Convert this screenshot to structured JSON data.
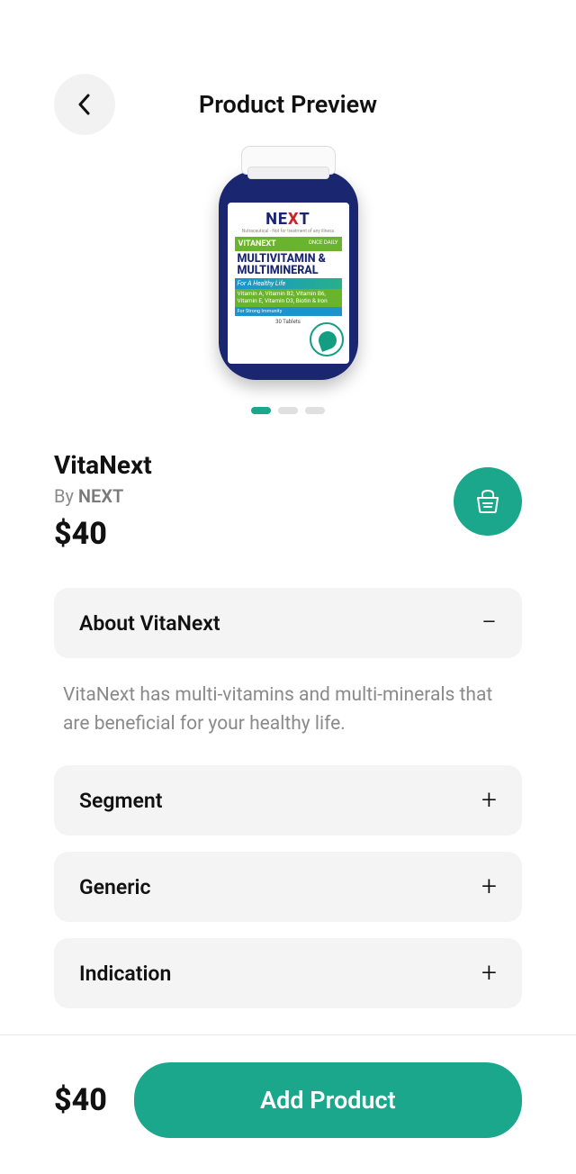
{
  "header": {
    "title": "Product Preview"
  },
  "product": {
    "name": "VitaNext",
    "by_prefix": "By ",
    "brand": "NEXT",
    "price": "$40",
    "bottle_label": {
      "brand_left": "NE",
      "brand_x": "X",
      "brand_right": "T",
      "sub": "Nutraceutical - Not for treatment of any illness",
      "vitanext": "VITANEXT",
      "oncedaily": "ONCE DAILY",
      "multivit": "MULTIVITAMIN & MULTIMINERAL",
      "healthy": "For A Healthy Life",
      "vitamins": "Vitamin A, Vitamin B2, Vitamin B6, Vitamin E, Vitamin D3, Biotin & Iron",
      "immunity": "For Strong Immunity",
      "tablets": "30 Tablets"
    }
  },
  "pagination": {
    "count": 3,
    "active": 0
  },
  "accordion": [
    {
      "title": "About VitaNext",
      "expanded": true,
      "content": "VitaNext has multi-vitamins and multi-minerals that are beneficial for your healthy life."
    },
    {
      "title": "Segment",
      "expanded": false
    },
    {
      "title": "Generic",
      "expanded": false
    },
    {
      "title": "Indication",
      "expanded": false
    }
  ],
  "bottom": {
    "price": "$40",
    "cta": "Add Product"
  },
  "colors": {
    "accent": "#1aa78b"
  }
}
